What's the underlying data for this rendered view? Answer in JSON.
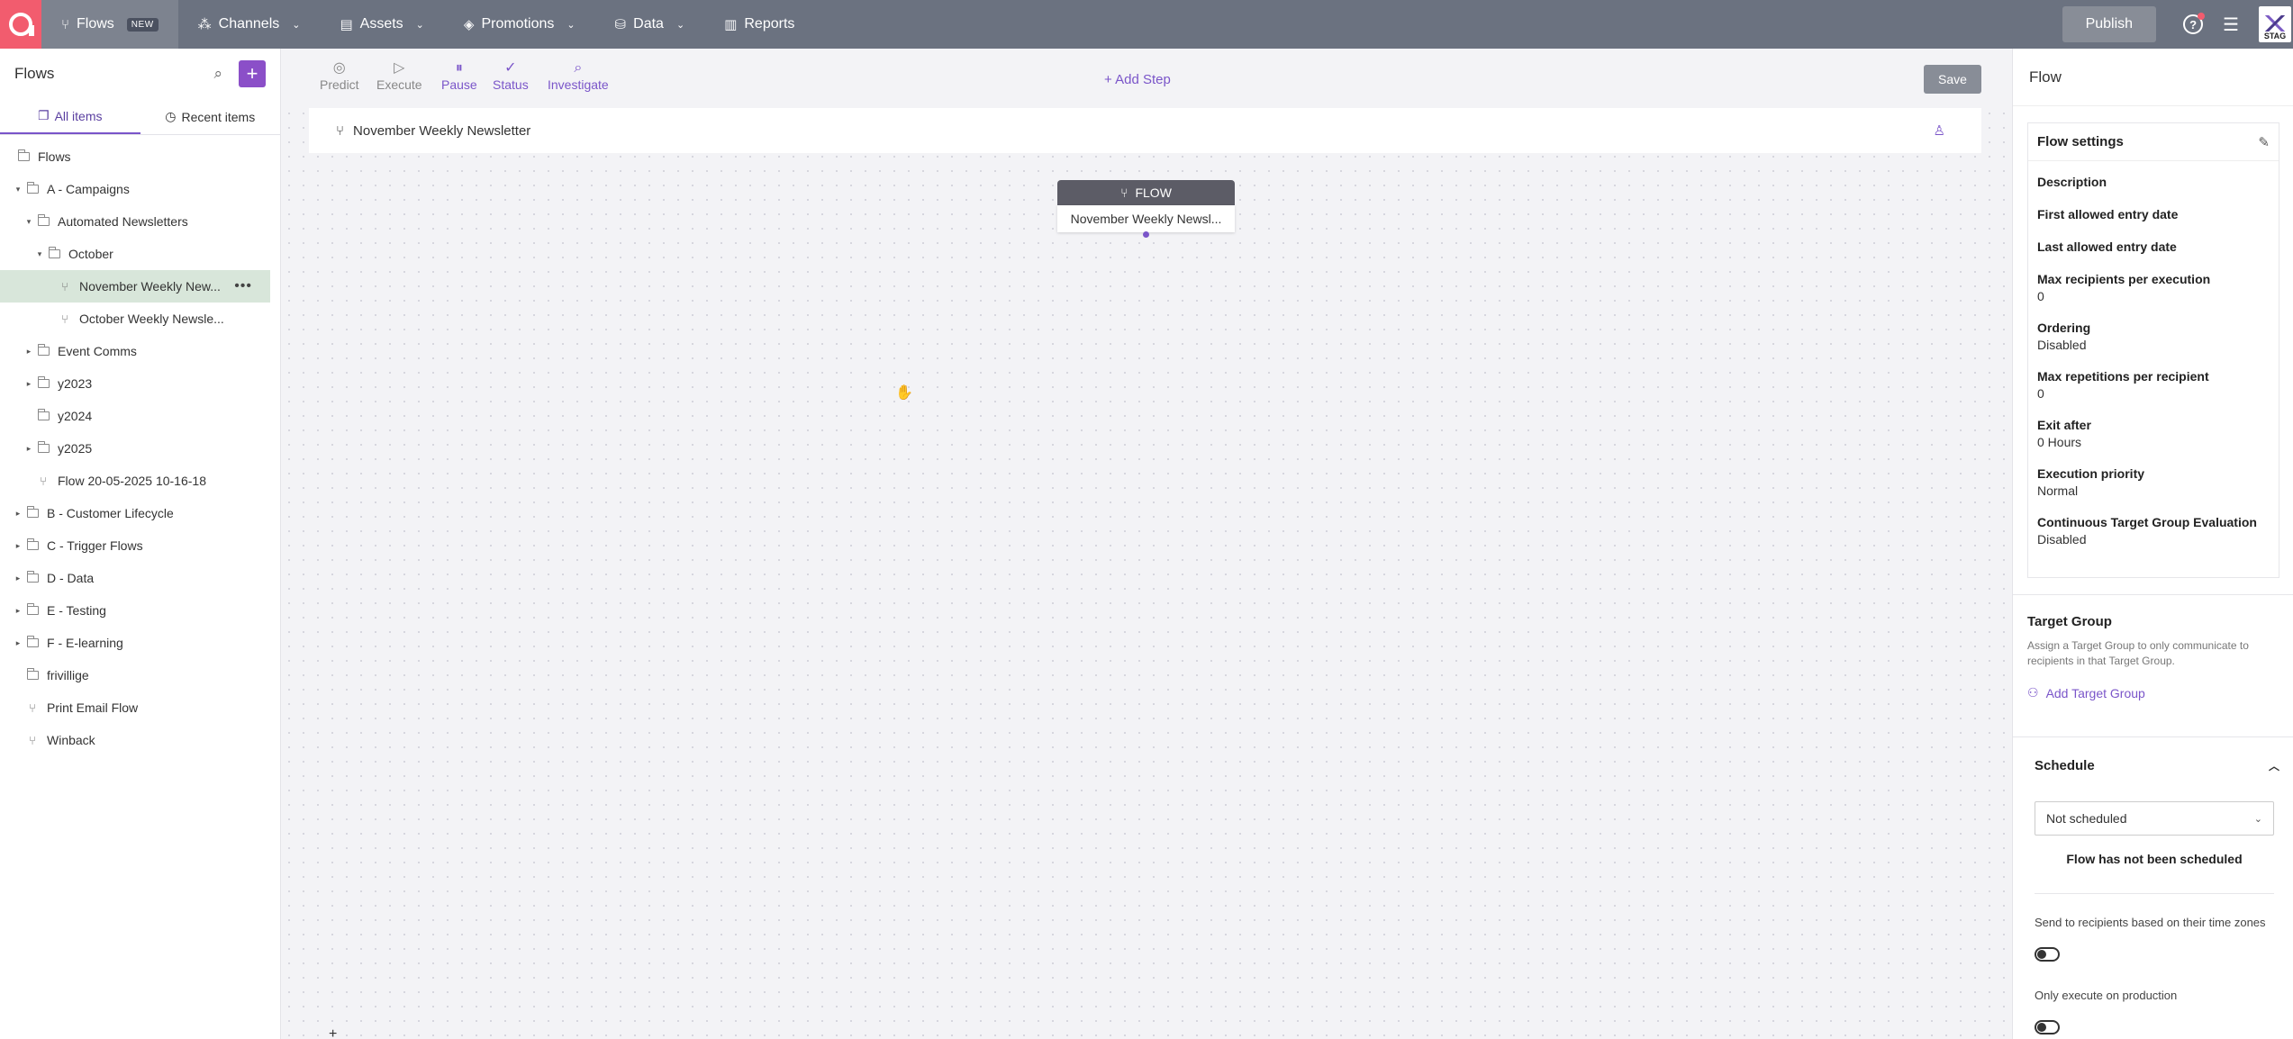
{
  "topnav": {
    "items": [
      {
        "label": "Flows",
        "badge": "NEW",
        "icon": "flows-icon"
      },
      {
        "label": "Channels",
        "icon": "channels-icon"
      },
      {
        "label": "Assets",
        "icon": "assets-icon"
      },
      {
        "label": "Promotions",
        "icon": "promotions-icon"
      },
      {
        "label": "Data",
        "icon": "database-icon"
      },
      {
        "label": "Reports",
        "icon": "bar-chart-icon"
      }
    ],
    "publish_label": "Publish",
    "env_label": "STAG"
  },
  "sidebar": {
    "title": "Flows",
    "add_label": "+",
    "tabs": [
      {
        "label": "All items"
      },
      {
        "label": "Recent items"
      }
    ],
    "tree": [
      {
        "label": "Flows"
      },
      {
        "label": "A - Campaigns"
      },
      {
        "label": "Automated Newsletters"
      },
      {
        "label": "October"
      },
      {
        "label": "November Weekly New...",
        "selected": true
      },
      {
        "label": "October Weekly Newsle..."
      },
      {
        "label": "Event Comms"
      },
      {
        "label": "y2023"
      },
      {
        "label": "y2024"
      },
      {
        "label": "y2025"
      },
      {
        "label": "Flow 20-05-2025 10-16-18"
      },
      {
        "label": "B - Customer Lifecycle"
      },
      {
        "label": "C - Trigger Flows"
      },
      {
        "label": "D - Data"
      },
      {
        "label": "E - Testing"
      },
      {
        "label": "F - E-learning"
      },
      {
        "label": "frivillige"
      },
      {
        "label": "Print Email Flow"
      },
      {
        "label": "Winback"
      }
    ]
  },
  "toolbar": {
    "tools": [
      {
        "label": "Predict"
      },
      {
        "label": "Execute"
      },
      {
        "label": "Pause"
      },
      {
        "label": "Status"
      },
      {
        "label": "Investigate"
      }
    ],
    "add_step_label": "Add Step",
    "save_label": "Save"
  },
  "flow": {
    "name": "November Weekly Newsletter",
    "node_type": "FLOW",
    "node_name": "November Weekly Newsl..."
  },
  "panel": {
    "title": "Flow",
    "settings_title": "Flow settings",
    "fields": [
      {
        "label": "Description",
        "value": ""
      },
      {
        "label": "First allowed entry date",
        "value": ""
      },
      {
        "label": "Last allowed entry date",
        "value": ""
      },
      {
        "label": "Max recipients per execution",
        "value": "0"
      },
      {
        "label": "Ordering",
        "value": "Disabled"
      },
      {
        "label": "Max repetitions per recipient",
        "value": "0"
      },
      {
        "label": "Exit after",
        "value": "0 Hours"
      },
      {
        "label": "Execution priority",
        "value": "Normal"
      },
      {
        "label": "Continuous Target Group Evaluation",
        "value": "Disabled"
      }
    ],
    "target_group": {
      "title": "Target Group",
      "description": "Assign a Target Group to only communicate to recipients in that Target Group.",
      "add_label": "Add Target Group"
    },
    "schedule": {
      "title": "Schedule",
      "selected": "Not scheduled",
      "status": "Flow has not been scheduled",
      "timezone_label": "Send to recipients based on their time zones",
      "production_label": "Only execute on production"
    }
  }
}
